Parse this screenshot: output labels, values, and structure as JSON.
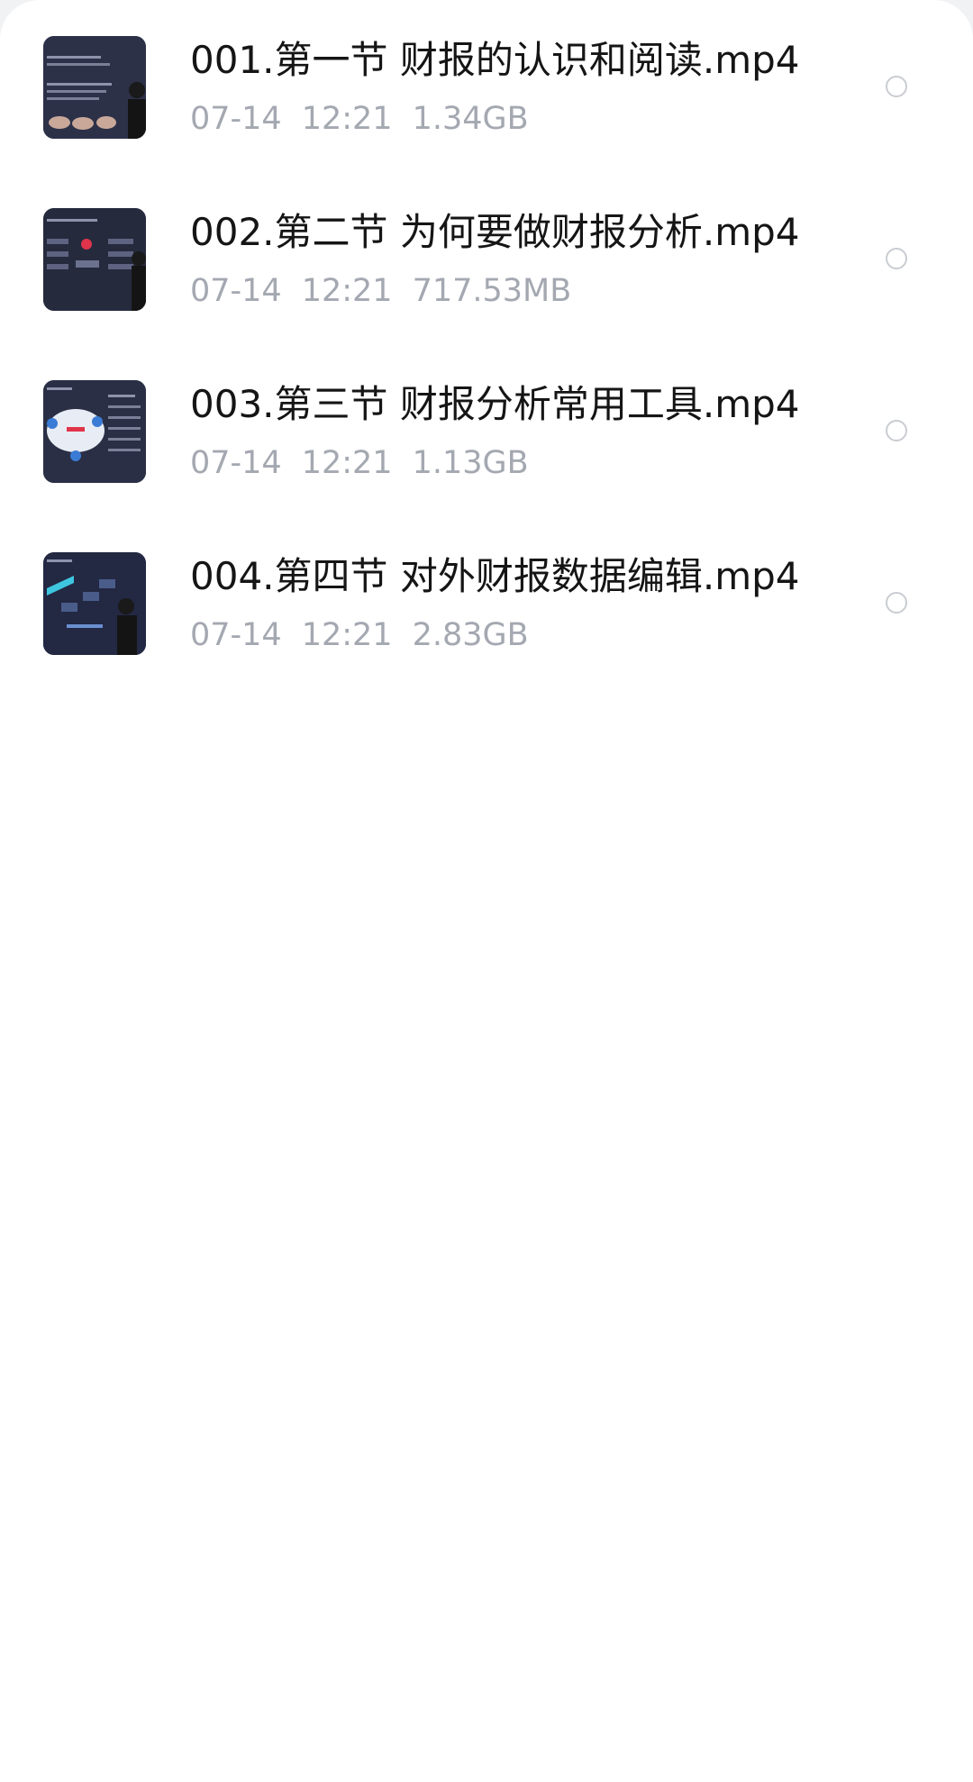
{
  "files": [
    {
      "name": "001.第一节 财报的认识和阅读.mp4",
      "date": "07-14",
      "time": "12:21",
      "size": "1.34GB",
      "thumbnail": "video-thumbnail-presenter"
    },
    {
      "name": "002.第二节 为何要做财报分析.mp4",
      "date": "07-14",
      "time": "12:21",
      "size": "717.53MB",
      "thumbnail": "video-thumbnail-presenter"
    },
    {
      "name": "003.第三节 财报分析常用工具.mp4",
      "date": "07-14",
      "time": "12:21",
      "size": "1.13GB",
      "thumbnail": "video-thumbnail-presenter"
    },
    {
      "name": "004.第四节 对外财报数据编辑.mp4",
      "date": "07-14",
      "time": "12:21",
      "size": "2.83GB",
      "thumbnail": "video-thumbnail-presenter"
    }
  ],
  "colors": {
    "title": "#151515",
    "meta": "#a4a8b1",
    "radio_border": "#c9ccd2",
    "background": "#ffffff"
  }
}
